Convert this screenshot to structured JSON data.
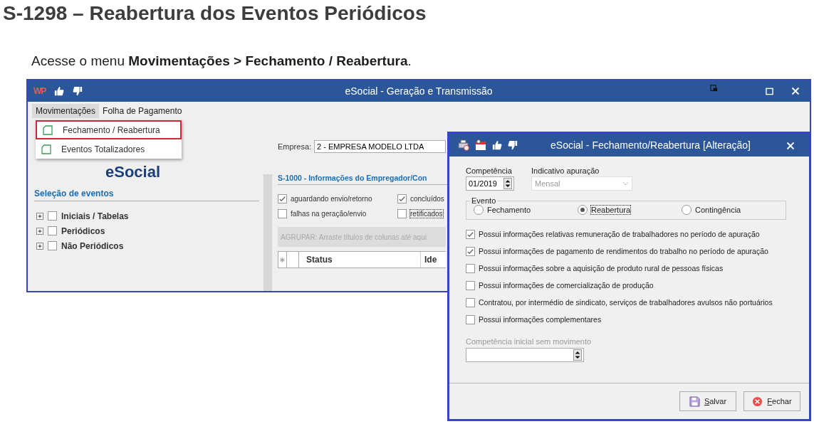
{
  "heading": "S-1298 – Reabertura dos Eventos Periódicos",
  "instruction": "Acesse o menu **Movimentações > Fechamento / Reabertura**.",
  "main_window": {
    "app_logo": "WP",
    "title": "eSocial - Geração e Transmissão",
    "menu": [
      {
        "label": "Movimentações",
        "selected": true
      },
      {
        "label": "Folha de Pagamento",
        "selected": false
      }
    ],
    "dropdown": [
      {
        "label": "Fechamento / Reabertura",
        "highlighted": true
      },
      {
        "label": "Eventos Totalizadores",
        "highlighted": false
      }
    ],
    "logo": "eSocial",
    "events_heading": "Seleção de eventos",
    "event_tree": [
      {
        "label": "Iniciais / Tabelas",
        "expanded": false,
        "checked": false
      },
      {
        "label": "Periódicos",
        "expanded": false,
        "checked": false
      },
      {
        "label": "Não Periódicos",
        "expanded": false,
        "checked": false
      }
    ],
    "company_label": "Empresa:",
    "company_value": "2 - EMPRESA MODELO LTDA",
    "section_heading": "S-1000 - Informações do Empregador/Con",
    "filters": [
      {
        "label": "aguardando envio/retorno",
        "checked": true
      },
      {
        "label": "concluídos",
        "checked": true
      },
      {
        "label": "falhas na geração/envio",
        "checked": false
      },
      {
        "label": "retificados",
        "checked": false
      }
    ],
    "group_hint": "AGRUPAR: Arraste títulos de colunas até aqui",
    "grid_columns": [
      "Status",
      "Ide"
    ]
  },
  "dialog": {
    "title": "eSocial - Fechamento/Reabertura [Alteração]",
    "competencia_label": "Competência",
    "competencia_value": "01/2019",
    "indicativo_label": "Indicativo apuração",
    "indicativo_value": "Mensal",
    "indicativo_disabled": true,
    "evento_label": "Evento",
    "evento_options": [
      {
        "label": "Fechamento",
        "selected": false
      },
      {
        "label": "Reabertura",
        "selected": true
      },
      {
        "label": "Contingência",
        "selected": false
      }
    ],
    "options": [
      {
        "label": "Possui informações relativas remuneração de trabalhadores no período de apuração",
        "checked": true
      },
      {
        "label": "Possui informações de pagamento de rendimentos do trabalho no período de apuração",
        "checked": true
      },
      {
        "label": "Possui informações sobre a aquisição de produto rural de pessoas físicas",
        "checked": false
      },
      {
        "label": "Possui informações de comercialização de produção",
        "checked": false
      },
      {
        "label": "Contratou, por intermédio de sindicato, serviços de trabalhadores avulsos não portuários",
        "checked": false
      },
      {
        "label": "Possui informações complementares",
        "checked": false
      }
    ],
    "inicial_label": "Competência inicial sem movimento",
    "inicial_disabled": true,
    "buttons": [
      "Salvar",
      "Fechar"
    ]
  }
}
